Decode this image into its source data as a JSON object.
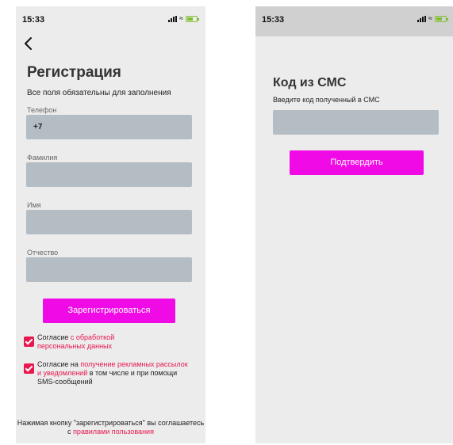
{
  "left": {
    "status": {
      "time": "15:33"
    },
    "title": "Регистрация",
    "subtitle": "Все поля обязательны для заполнения",
    "fields": [
      {
        "label": "Телефон",
        "value": "+7"
      },
      {
        "label": "Фамилия",
        "value": ""
      },
      {
        "label": "Имя",
        "value": ""
      },
      {
        "label": "Отчество",
        "value": ""
      }
    ],
    "register_button": "Зарегистрироваться",
    "consent1": {
      "text": "Согласие ",
      "link": "с обработкой персональных данных"
    },
    "consent2": {
      "text": "Согласие на ",
      "link": "получение рекламных рассылок и уведомлений",
      "text_after": " в том числе и при помощи SMS-сообщений"
    },
    "footer": {
      "text": "Нажимая кнопку \"зарегистрироваться\" вы соглашаетесь с ",
      "link": "правилами пользования"
    }
  },
  "right": {
    "status": {
      "time": "15:33"
    },
    "title": "Код из СМС",
    "subtitle": "Введите код полученный в СМС",
    "code_value": "",
    "confirm_button": "Подтвердить"
  },
  "colors": {
    "accent": "#f00be6",
    "link": "#e8174e",
    "field": "#b4bcc4",
    "background": "#ececec",
    "battery": "#7fbe2f"
  },
  "icons": [
    "back-arrow-icon",
    "signal-icon",
    "wifi-icon",
    "battery-icon",
    "checkmark-icon"
  ]
}
